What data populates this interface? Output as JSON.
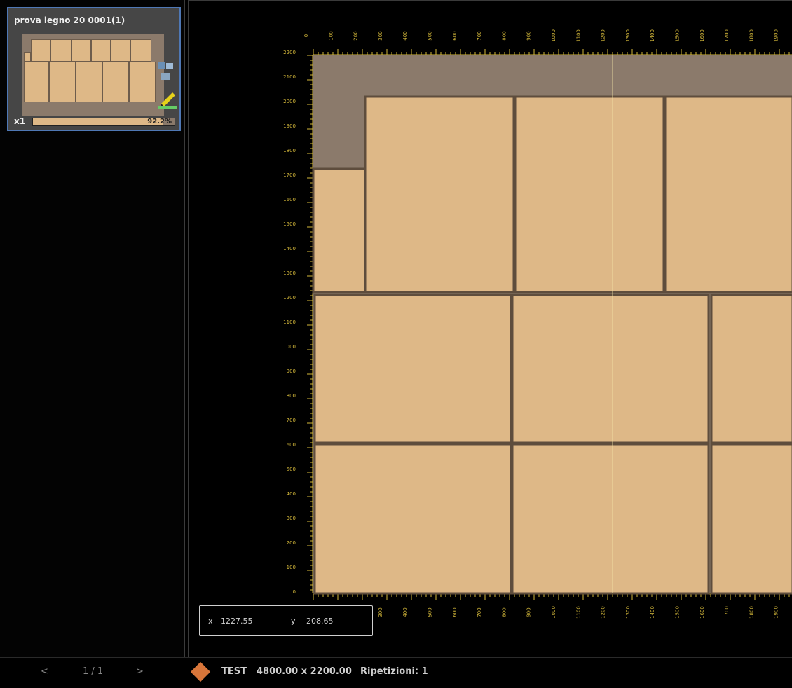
{
  "sidebar": {
    "sheet_title": "prova legno 20 0001(1)",
    "quantity": "x1",
    "usage_label": "92.2%",
    "usage_fraction": 0.922
  },
  "viewer": {
    "x_ticks": [
      "0",
      "100",
      "200",
      "300",
      "400",
      "500",
      "600",
      "700",
      "800",
      "900",
      "1000",
      "1100",
      "1200",
      "1300",
      "1400",
      "1500",
      "1600",
      "1700",
      "1800",
      "1900",
      "2000"
    ],
    "y_ticks": [
      "2200",
      "2100",
      "2000",
      "1900",
      "1800",
      "1700",
      "1600",
      "1500",
      "1400",
      "1300",
      "1200",
      "1100",
      "1000",
      "900",
      "800",
      "700",
      "600",
      "500",
      "400",
      "300",
      "200",
      "100",
      "0"
    ],
    "coordinates": {
      "x_label": "x",
      "x_value": "1227.55",
      "y_label": "y",
      "y_value": "208.65"
    },
    "colors": {
      "sheet": "#8b7a6b",
      "part": "#deb887",
      "gap": "#5e4d3d",
      "ruler": "#d4b83a",
      "cursor": "#f5e6a8"
    }
  },
  "statusbar": {
    "prev_icon": "chevron-left-icon",
    "prev": "<",
    "page": "1 / 1",
    "next_icon": "chevron-right-icon",
    "next": ">",
    "material_icon": "material-diamond-icon",
    "material_code": "TEST",
    "material_size": "4800.00 x 2200.00",
    "repetitions": "Ripetizioni: 1"
  }
}
